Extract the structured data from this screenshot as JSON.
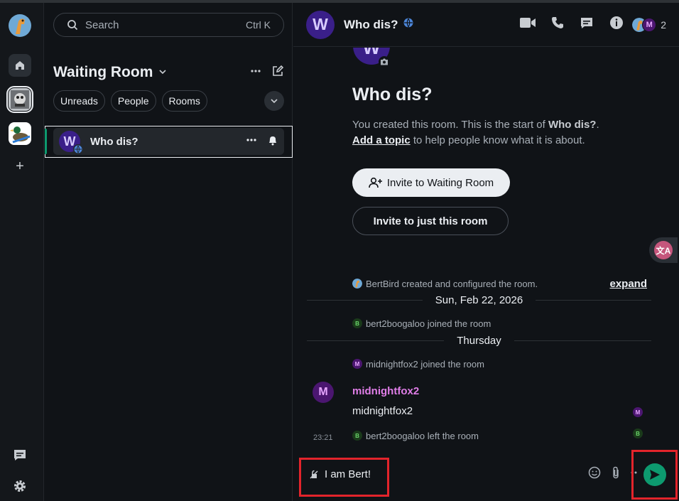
{
  "search": {
    "placeholder": "Search",
    "shortcut": "Ctrl K"
  },
  "room_list": {
    "title": "Waiting Room",
    "filters": [
      "Unreads",
      "People",
      "Rooms"
    ],
    "rooms": [
      {
        "avatar_letter": "W",
        "name": "Who dis?"
      }
    ]
  },
  "room": {
    "avatar_letter": "W",
    "name": "Who dis?",
    "member_letter": "M",
    "member_count": "2"
  },
  "intro": {
    "title": "Who dis?",
    "text_prefix": "You created this room. This is the start of ",
    "text_room": "Who dis?",
    "text_suffix": ".",
    "add_topic": "Add a topic",
    "add_topic_suffix": " to help people know what it is about.",
    "invite_space": "Invite to Waiting Room",
    "invite_room": "Invite to just this room"
  },
  "timeline": {
    "summary": "BertBird created and configured the room.",
    "expand": "expand",
    "date1": "Sun, Feb 22, 2026",
    "event1": {
      "letter": "B",
      "text": "bert2boogaloo joined the room"
    },
    "date2": "Thursday",
    "event2": {
      "letter": "M",
      "text": "midnightfox2 joined the room"
    },
    "message": {
      "avatar_letter": "M",
      "sender": "midnightfox2",
      "body": "midnightfox2",
      "receipt_letter": "M"
    },
    "event3": {
      "timestamp": "23:21",
      "letter": "B",
      "text": "bert2boogaloo left the room",
      "receipt_letter": "B"
    }
  },
  "composer": {
    "text": "I am Bert!"
  },
  "translate": {
    "label": "文A"
  },
  "colors": {
    "accent": "#0d9a6f",
    "annotation": "#e3242b",
    "room_avatar": "#3a1f89",
    "member_m": "#e07ee8"
  }
}
